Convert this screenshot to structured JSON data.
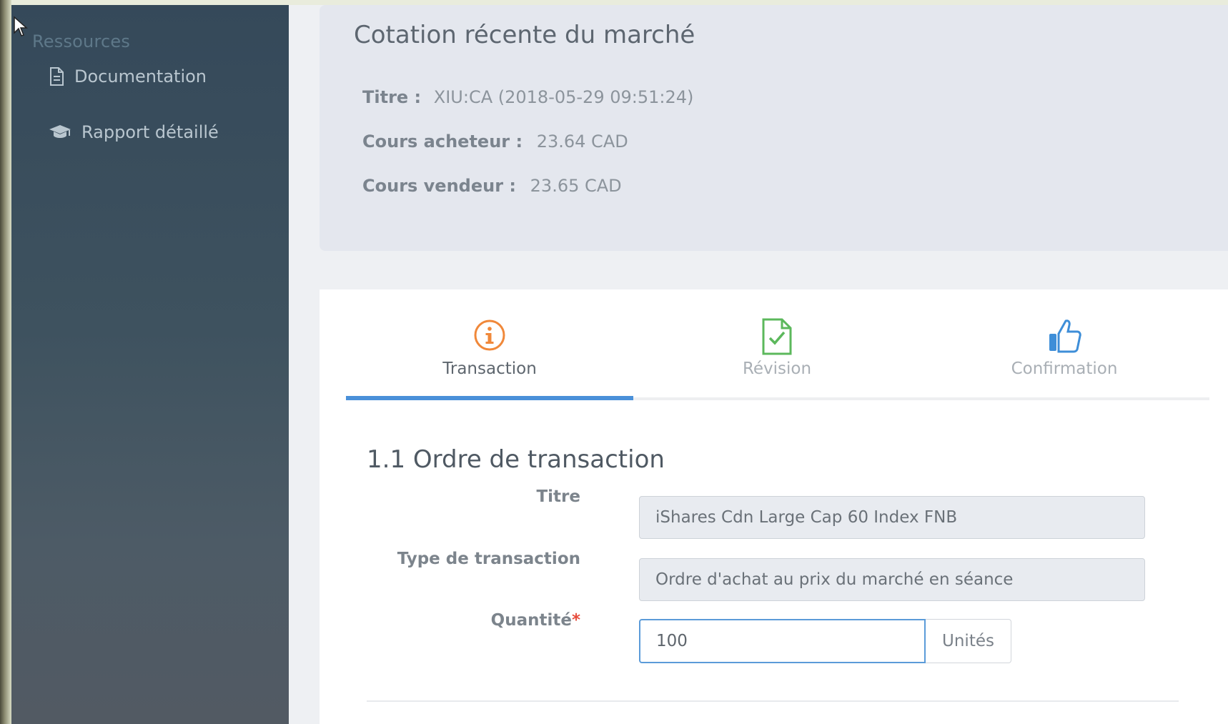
{
  "sidebar": {
    "section_title": "Ressources",
    "items": [
      {
        "label": "Documentation",
        "icon": "document-icon"
      },
      {
        "label": "Rapport détaillé",
        "icon": "graduation-cap-icon"
      }
    ]
  },
  "quote": {
    "title": "Cotation récente du marché",
    "titre_label": "Titre :",
    "titre_value": "XIU:CA (2018-05-29 09:51:24)",
    "bid_label": "Cours acheteur :",
    "bid_value": "23.64 CAD",
    "ask_label": "Cours vendeur :",
    "ask_value": "23.65 CAD"
  },
  "wizard": {
    "tabs": [
      {
        "label": "Transaction",
        "icon": "info-circle-icon",
        "color": "#f0883a",
        "active": true
      },
      {
        "label": "Révision",
        "icon": "document-check-icon",
        "color": "#5cb85c",
        "active": false
      },
      {
        "label": "Confirmation",
        "icon": "thumbs-up-icon",
        "color": "#3e8ed8",
        "active": false
      }
    ],
    "active_color": "#4a90d9"
  },
  "form": {
    "section_title": "1.1 Ordre de transaction",
    "titre": {
      "label": "Titre",
      "value": "iShares Cdn Large Cap  60 Index FNB"
    },
    "type": {
      "label": "Type de transaction",
      "value": "Ordre d'achat au prix du marché en séance"
    },
    "quantite": {
      "label": "Quantité",
      "required_mark": "*",
      "value": "100",
      "unit": "Unités"
    }
  }
}
